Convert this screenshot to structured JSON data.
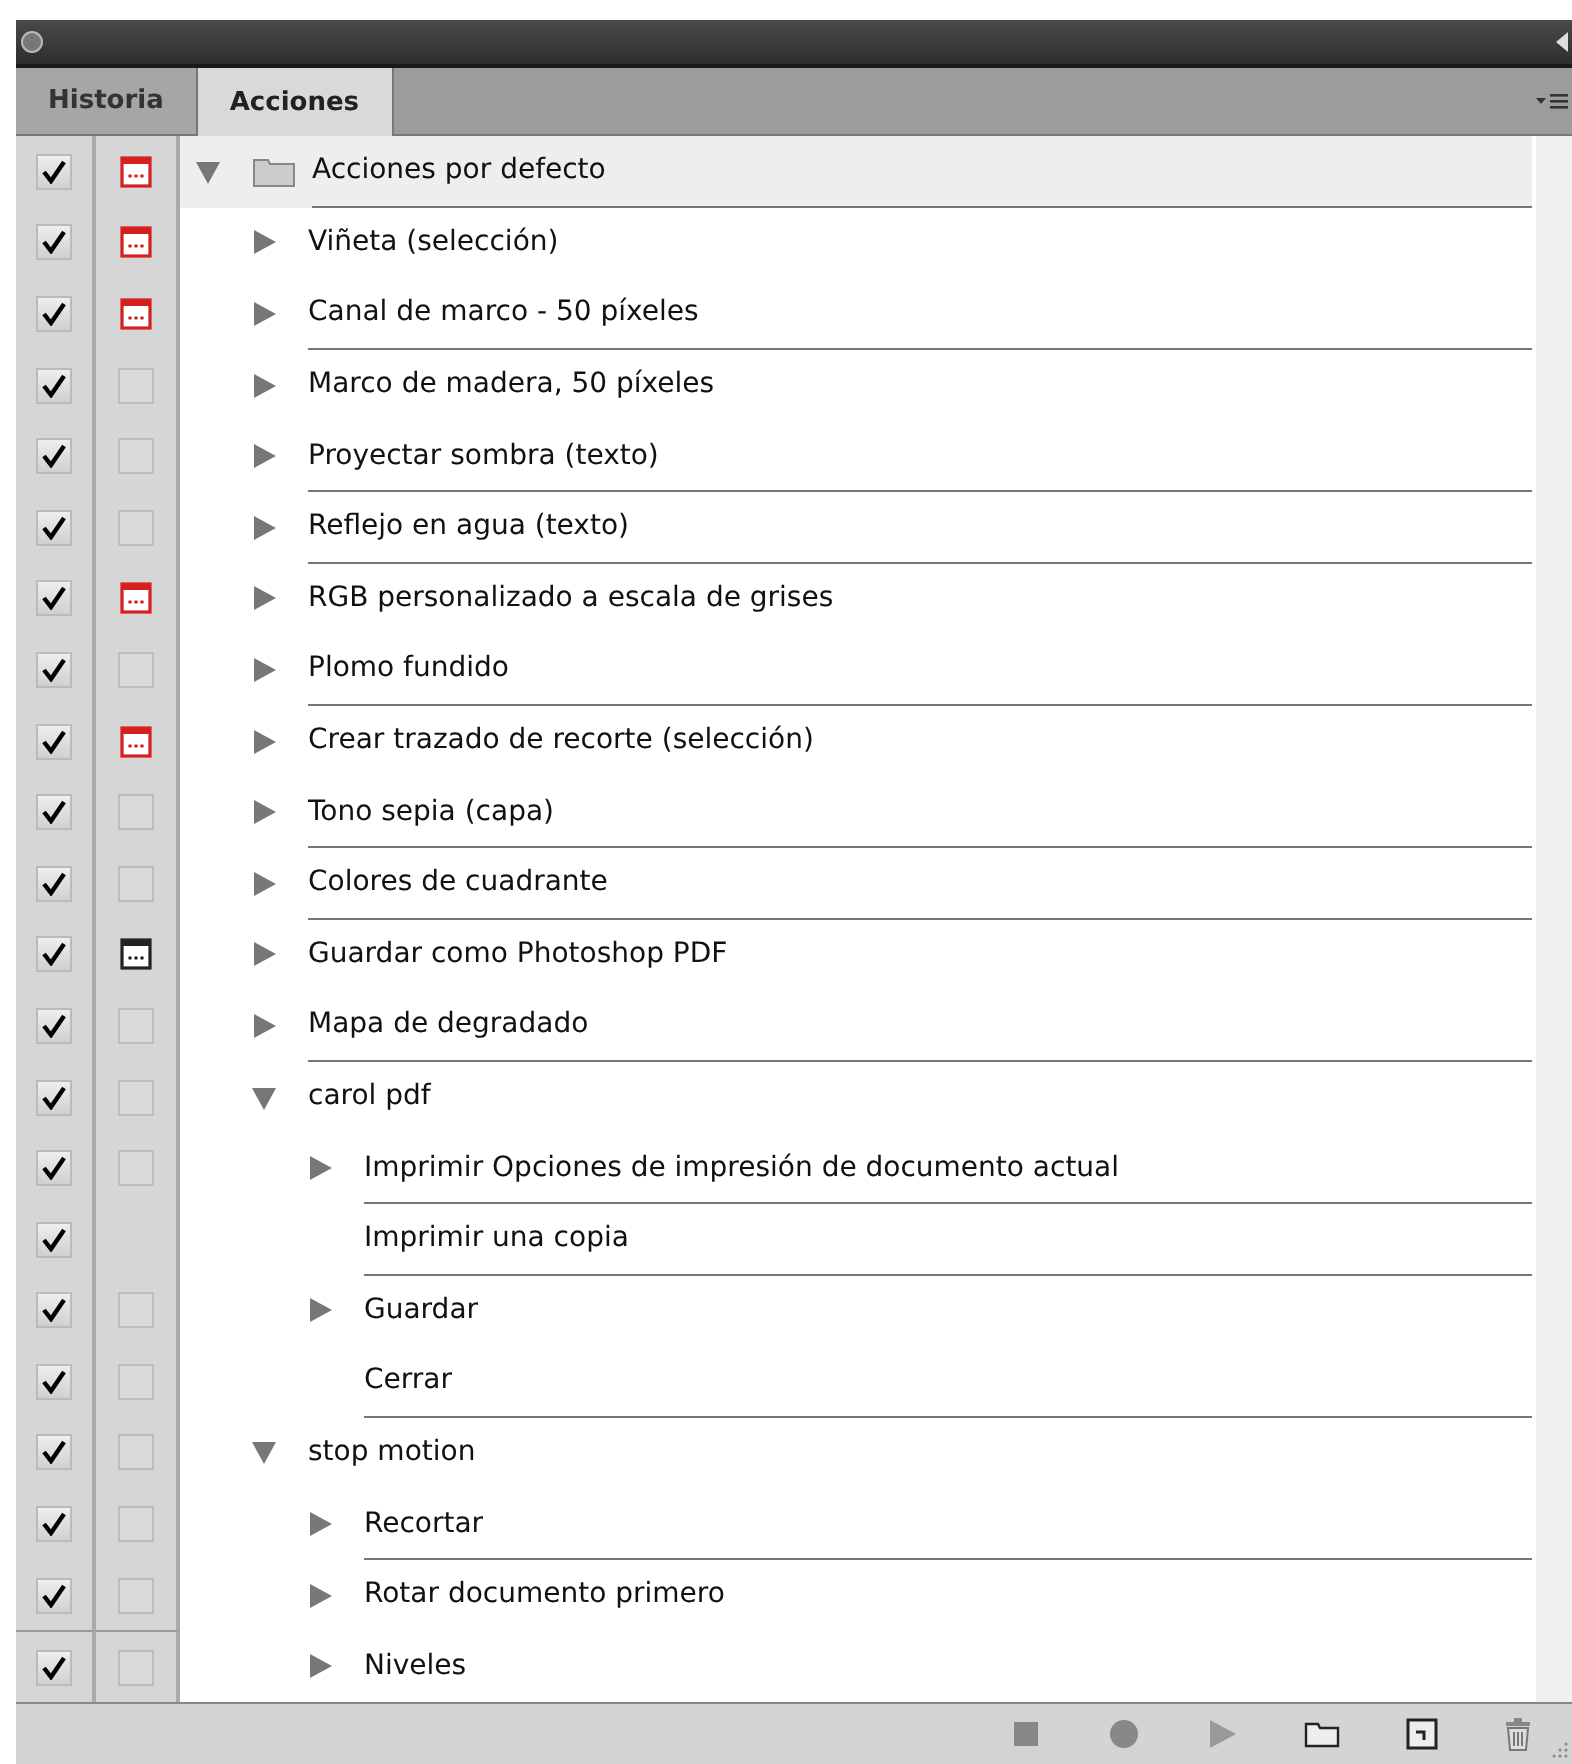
{
  "tabs": [
    {
      "label": "Historia",
      "selected": false
    },
    {
      "label": "Acciones",
      "selected": true
    }
  ],
  "sets": [
    {
      "kind": "set",
      "label": "Acciones por defecto",
      "checked": true,
      "modal": true,
      "partial": true,
      "expanded": true,
      "children": [
        {
          "kind": "action",
          "label": "Viñeta (selección)",
          "checked": true,
          "modal": true,
          "partial": true,
          "expanded": false
        },
        {
          "kind": "action",
          "label": "Canal de marco - 50 píxeles",
          "checked": true,
          "modal": true,
          "partial": true,
          "expanded": false
        },
        {
          "kind": "action",
          "label": "Marco de madera, 50 píxeles",
          "checked": true,
          "modal": false,
          "expanded": false
        },
        {
          "kind": "action",
          "label": "Proyectar sombra (texto)",
          "checked": true,
          "modal": false,
          "expanded": false
        },
        {
          "kind": "action",
          "label": "Reflejo en agua (texto)",
          "checked": true,
          "modal": false,
          "expanded": false
        },
        {
          "kind": "action",
          "label": "RGB personalizado a escala de grises",
          "checked": true,
          "modal": true,
          "partial": true,
          "expanded": false
        },
        {
          "kind": "action",
          "label": "Plomo fundido",
          "checked": true,
          "modal": false,
          "expanded": false
        },
        {
          "kind": "action",
          "label": "Crear trazado de recorte (selección)",
          "checked": true,
          "modal": true,
          "partial": true,
          "expanded": false
        },
        {
          "kind": "action",
          "label": "Tono sepia (capa)",
          "checked": true,
          "modal": false,
          "expanded": false
        },
        {
          "kind": "action",
          "label": "Colores de cuadrante",
          "checked": true,
          "modal": false,
          "expanded": false
        },
        {
          "kind": "action",
          "label": "Guardar como Photoshop PDF",
          "checked": true,
          "modal": true,
          "partial": false,
          "expanded": false
        },
        {
          "kind": "action",
          "label": "Mapa de degradado",
          "checked": true,
          "modal": false,
          "expanded": false
        },
        {
          "kind": "action",
          "label": "carol pdf",
          "checked": true,
          "modal": false,
          "expanded": true,
          "children": [
            {
              "kind": "command",
              "label": "Imprimir Opciones de impresión de documento actual",
              "checked": true,
              "modal": false,
              "expanded": false
            },
            {
              "kind": "step",
              "label": "Imprimir una copia",
              "checked": true
            },
            {
              "kind": "command",
              "label": "Guardar",
              "checked": true,
              "modal": false,
              "expanded": false
            },
            {
              "kind": "step",
              "label": "Cerrar",
              "checked": true,
              "modal": false
            }
          ]
        },
        {
          "kind": "action",
          "label": "stop motion",
          "checked": true,
          "modal": false,
          "expanded": true,
          "children": [
            {
              "kind": "command",
              "label": "Recortar",
              "checked": true,
              "modal": false,
              "expanded": false
            },
            {
              "kind": "command",
              "label": "Rotar documento primero",
              "checked": true,
              "modal": false,
              "expanded": false
            },
            {
              "kind": "command",
              "label": "Niveles",
              "checked": true,
              "modal": false,
              "expanded": false
            }
          ]
        }
      ]
    }
  ]
}
